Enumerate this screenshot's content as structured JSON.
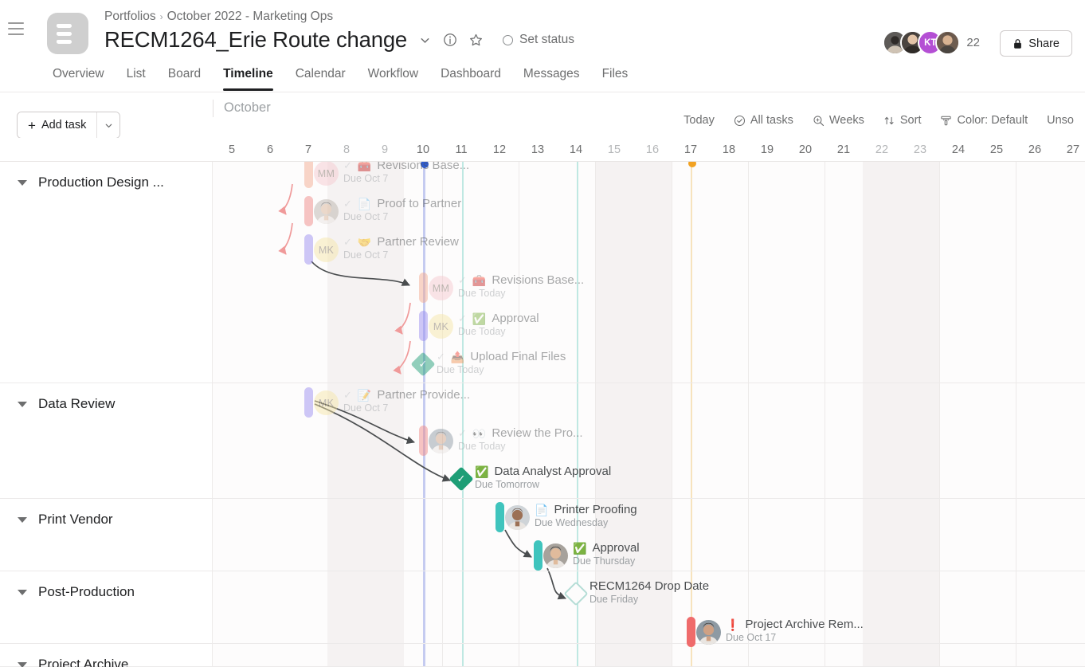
{
  "header": {
    "breadcrumb": [
      "Portfolios",
      "October 2022 - Marketing Ops"
    ],
    "breadcrumb_separator": "›",
    "project_title": "RECM1264_Erie Route change",
    "set_status_label": "Set status",
    "share_label": "Share",
    "member_overflow_count": "22",
    "avatars": [
      {
        "initials": "",
        "color": "#5a5f63"
      },
      {
        "initials": "",
        "color": "#3d3a38"
      },
      {
        "initials": "KT",
        "color": "#b44fd4"
      },
      {
        "initials": "",
        "color": "#6b5a4e"
      }
    ],
    "icons": {
      "menu": "hamburger-icon",
      "project": "project-list-icon",
      "dropdown": "chevron-down-icon",
      "info": "info-icon",
      "star": "star-icon",
      "status": "status-circle-icon",
      "lock": "lock-icon"
    }
  },
  "tabs": [
    {
      "label": "Overview",
      "active": false
    },
    {
      "label": "List",
      "active": false
    },
    {
      "label": "Board",
      "active": false
    },
    {
      "label": "Timeline",
      "active": true
    },
    {
      "label": "Calendar",
      "active": false
    },
    {
      "label": "Workflow",
      "active": false
    },
    {
      "label": "Dashboard",
      "active": false
    },
    {
      "label": "Messages",
      "active": false
    },
    {
      "label": "Files",
      "active": false
    }
  ],
  "toolbar": {
    "add_task_label": "Add task",
    "add_task_plus": "+",
    "items": [
      {
        "label": "Today",
        "icon": ""
      },
      {
        "label": "All tasks",
        "icon": "check-circle-icon"
      },
      {
        "label": "Weeks",
        "icon": "zoom-icon"
      },
      {
        "label": "Sort",
        "icon": "sort-icon"
      },
      {
        "label": "Color: Default",
        "icon": "paint-icon"
      },
      {
        "label": "Unso",
        "icon": ""
      }
    ]
  },
  "timeline": {
    "month_label": "October",
    "days": [
      {
        "n": "5",
        "weekend": false
      },
      {
        "n": "6",
        "weekend": false
      },
      {
        "n": "7",
        "weekend": false
      },
      {
        "n": "8",
        "weekend": true
      },
      {
        "n": "9",
        "weekend": true
      },
      {
        "n": "10",
        "weekend": false
      },
      {
        "n": "11",
        "weekend": false
      },
      {
        "n": "12",
        "weekend": false
      },
      {
        "n": "13",
        "weekend": false
      },
      {
        "n": "14",
        "weekend": false
      },
      {
        "n": "15",
        "weekend": true
      },
      {
        "n": "16",
        "weekend": true
      },
      {
        "n": "17",
        "weekend": false
      },
      {
        "n": "18",
        "weekend": false
      },
      {
        "n": "19",
        "weekend": false
      },
      {
        "n": "20",
        "weekend": false
      },
      {
        "n": "21",
        "weekend": false
      },
      {
        "n": "22",
        "weekend": true
      },
      {
        "n": "23",
        "weekend": true
      },
      {
        "n": "24",
        "weekend": false
      },
      {
        "n": "25",
        "weekend": false
      },
      {
        "n": "26",
        "weekend": false
      },
      {
        "n": "27",
        "weekend": false
      }
    ],
    "today_day": "10",
    "goal_day": "17",
    "markers": {
      "today_color": "#2f5cd1",
      "goal_color": "#f2a222"
    },
    "sections": [
      {
        "name": "Production Design ...",
        "tasks": [
          {
            "name": "Revisions Base...",
            "due": "Due Oct 7",
            "emoji": "🧰",
            "assignee": "MM",
            "bar_color": "#f4a98e",
            "type": "bar",
            "complete": true,
            "faded": true
          },
          {
            "name": "Proof to Partner",
            "due": "Due Oct 7",
            "emoji": "📄",
            "assignee": "",
            "bar_color": "#ef8785",
            "type": "bar",
            "complete": true,
            "faded": true
          },
          {
            "name": "Partner Review",
            "due": "Due Oct 7",
            "emoji": "🤝",
            "assignee": "MK",
            "bar_color": "#9b8df0",
            "type": "bar",
            "complete": true,
            "faded": true
          },
          {
            "name": "Revisions Base...",
            "due": "Due Today",
            "emoji": "🧰",
            "assignee": "MM",
            "bar_color": "#f4a98e",
            "type": "bar",
            "complete": true,
            "faded": true
          },
          {
            "name": "Approval",
            "due": "Due Today",
            "emoji": "✅",
            "assignee": "MK",
            "bar_color": "#9b8df0",
            "type": "bar",
            "complete": true,
            "faded": true
          },
          {
            "name": "Upload Final Files",
            "due": "Due Today",
            "emoji": "📤",
            "assignee": "",
            "bar_color": "#1e9e76",
            "type": "milestone-done",
            "complete": true,
            "faded": true
          }
        ]
      },
      {
        "name": "Data Review",
        "tasks": [
          {
            "name": "Partner Provide...",
            "due": "Due Oct 7",
            "emoji": "📝",
            "assignee": "MK",
            "bar_color": "#9b8df0",
            "type": "bar",
            "complete": true,
            "faded": true
          },
          {
            "name": "Review the Pro...",
            "due": "Due Today",
            "emoji": "👀",
            "assignee": "",
            "bar_color": "#ef8785",
            "type": "bar",
            "complete": true,
            "faded": true
          },
          {
            "name": "Data Analyst Approval",
            "due": "Due Tomorrow",
            "emoji": "✅",
            "assignee": "",
            "bar_color": "#1e9e76",
            "type": "milestone-done",
            "complete": false,
            "faded": false
          }
        ]
      },
      {
        "name": "Print Vendor",
        "tasks": [
          {
            "name": "Printer Proofing",
            "due": "Due Wednesday",
            "emoji": "📄",
            "assignee": "",
            "bar_color": "#3fc4bd",
            "type": "bar",
            "complete": false,
            "faded": false
          },
          {
            "name": "Approval",
            "due": "Due Thursday",
            "emoji": "✅",
            "assignee": "",
            "bar_color": "#3fc4bd",
            "type": "bar",
            "complete": false,
            "faded": false
          }
        ]
      },
      {
        "name": "Post-Production",
        "tasks": [
          {
            "name": "RECM1264 Drop Date",
            "due": "Due Friday",
            "emoji": "",
            "assignee": "",
            "bar_color": "#b5ddd6",
            "type": "milestone-open",
            "complete": false,
            "faded": false
          }
        ]
      },
      {
        "name": "Project Archive",
        "tasks": [
          {
            "name": "Project Archive Rem...",
            "due": "Due Oct 17",
            "emoji": "❗",
            "assignee": "",
            "bar_color": "#ef6b6b",
            "type": "bar",
            "complete": false,
            "faded": false
          }
        ]
      }
    ]
  }
}
